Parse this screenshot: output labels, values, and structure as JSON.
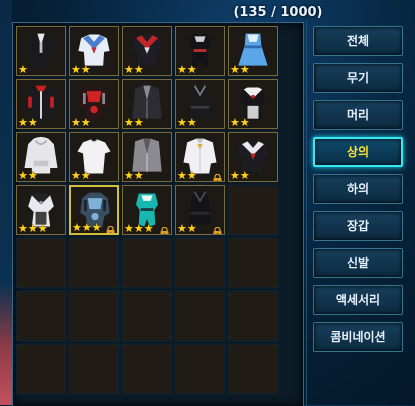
{
  "inventory": {
    "counter": "(135 / 1000)",
    "rows": [
      [
        {
          "filled": true,
          "icon": "black-blazer-uniform-icon",
          "stars": 1,
          "locked": false,
          "gold": false
        },
        {
          "filled": true,
          "icon": "blue-sailor-uniform-icon",
          "stars": 2,
          "locked": false,
          "gold": false
        },
        {
          "filled": true,
          "icon": "black-red-sailor-uniform-icon",
          "stars": 2,
          "locked": false,
          "gold": false
        },
        {
          "filled": true,
          "icon": "black-bodysuit-icon",
          "stars": 2,
          "locked": false,
          "gold": false
        },
        {
          "filled": true,
          "icon": "blue-dress-icon",
          "stars": 2,
          "locked": false,
          "gold": false
        }
      ],
      [
        {
          "filled": true,
          "icon": "red-black-jacket-icon",
          "stars": 2,
          "locked": false,
          "gold": false
        },
        {
          "filled": true,
          "icon": "red-armor-suit-icon",
          "stars": 2,
          "locked": false,
          "gold": false
        },
        {
          "filled": true,
          "icon": "dark-coat-icon",
          "stars": 2,
          "locked": false,
          "gold": false
        },
        {
          "filled": true,
          "icon": "black-halter-top-icon",
          "stars": 2,
          "locked": false,
          "gold": false
        },
        {
          "filled": true,
          "icon": "black-white-maid-top-icon",
          "stars": 2,
          "locked": false,
          "gold": false
        }
      ],
      [
        {
          "filled": true,
          "icon": "white-hoodie-icon",
          "stars": 2,
          "locked": false,
          "gold": false
        },
        {
          "filled": true,
          "icon": "white-tshirt-icon",
          "stars": 2,
          "locked": false,
          "gold": false
        },
        {
          "filled": true,
          "icon": "grey-cardigan-icon",
          "stars": 2,
          "locked": false,
          "gold": false
        },
        {
          "filled": true,
          "icon": "white-shirt-icon",
          "stars": 2,
          "locked": true,
          "gold": false
        },
        {
          "filled": true,
          "icon": "black-sailor-top-icon",
          "stars": 2,
          "locked": false,
          "gold": false
        }
      ],
      [
        {
          "filled": true,
          "icon": "white-corset-icon",
          "stars": 3,
          "locked": false,
          "gold": false
        },
        {
          "filled": true,
          "icon": "mech-armor-icon",
          "stars": 3,
          "locked": true,
          "gold": true
        },
        {
          "filled": true,
          "icon": "teal-mech-suit-icon",
          "stars": 3,
          "locked": true,
          "gold": false
        },
        {
          "filled": true,
          "icon": "black-bra-top-icon",
          "stars": 2,
          "locked": true,
          "gold": false
        },
        {
          "filled": false
        }
      ],
      [
        {
          "filled": false
        },
        {
          "filled": false
        },
        {
          "filled": false
        },
        {
          "filled": false
        },
        {
          "filled": false
        }
      ],
      [
        {
          "filled": false
        },
        {
          "filled": false
        },
        {
          "filled": false
        },
        {
          "filled": false
        },
        {
          "filled": false
        }
      ],
      [
        {
          "filled": false
        },
        {
          "filled": false
        },
        {
          "filled": false
        },
        {
          "filled": false
        },
        {
          "filled": false
        }
      ]
    ]
  },
  "categories": [
    {
      "label": "전체",
      "active": false
    },
    {
      "label": "무기",
      "active": false
    },
    {
      "label": "머리",
      "active": false
    },
    {
      "label": "상의",
      "active": true
    },
    {
      "label": "하의",
      "active": false
    },
    {
      "label": "장갑",
      "active": false
    },
    {
      "label": "신발",
      "active": false
    },
    {
      "label": "액세서리",
      "active": false
    },
    {
      "label": "콤비네이션",
      "active": false
    }
  ],
  "colors": {
    "accent": "#36e8f0",
    "active_text": "#ffe22f",
    "star": "#ffd21a",
    "lock": "#e0a020"
  }
}
